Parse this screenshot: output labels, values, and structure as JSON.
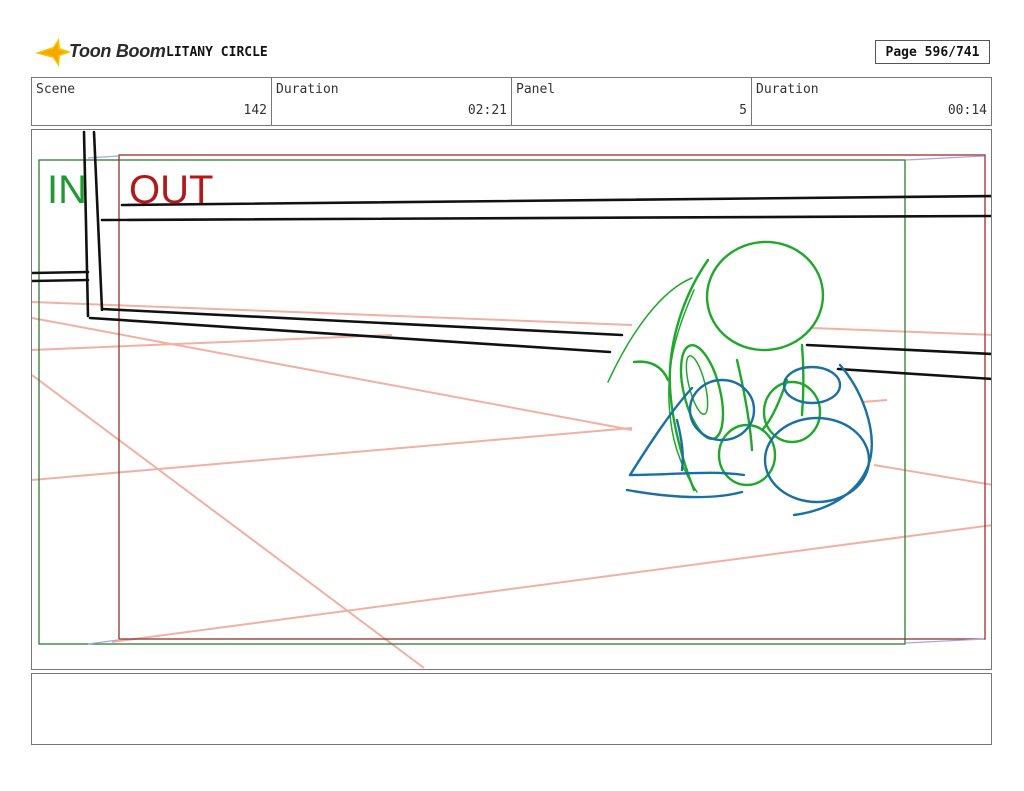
{
  "header": {
    "logo_text": "Toon Boom",
    "project_title": "LITANY CIRCLE",
    "page_counter": "Page 596/741"
  },
  "info": {
    "scene_label": "Scene",
    "scene_value": "142",
    "duration_label": "Duration",
    "duration_value": "02:21",
    "panel_label": "Panel",
    "panel_value": "5",
    "panel_duration_label": "Duration",
    "panel_duration_value": "00:14"
  },
  "panel": {
    "in_label": "IN",
    "out_label": "OUT",
    "in_frame_color": "#2e7d32",
    "out_frame_color": "#9b2c2c",
    "perspective_line_color": "#f0a898",
    "character_green": "#1fa82a",
    "character_blue": "#1a6fa3"
  },
  "notes": {
    "text": ""
  }
}
